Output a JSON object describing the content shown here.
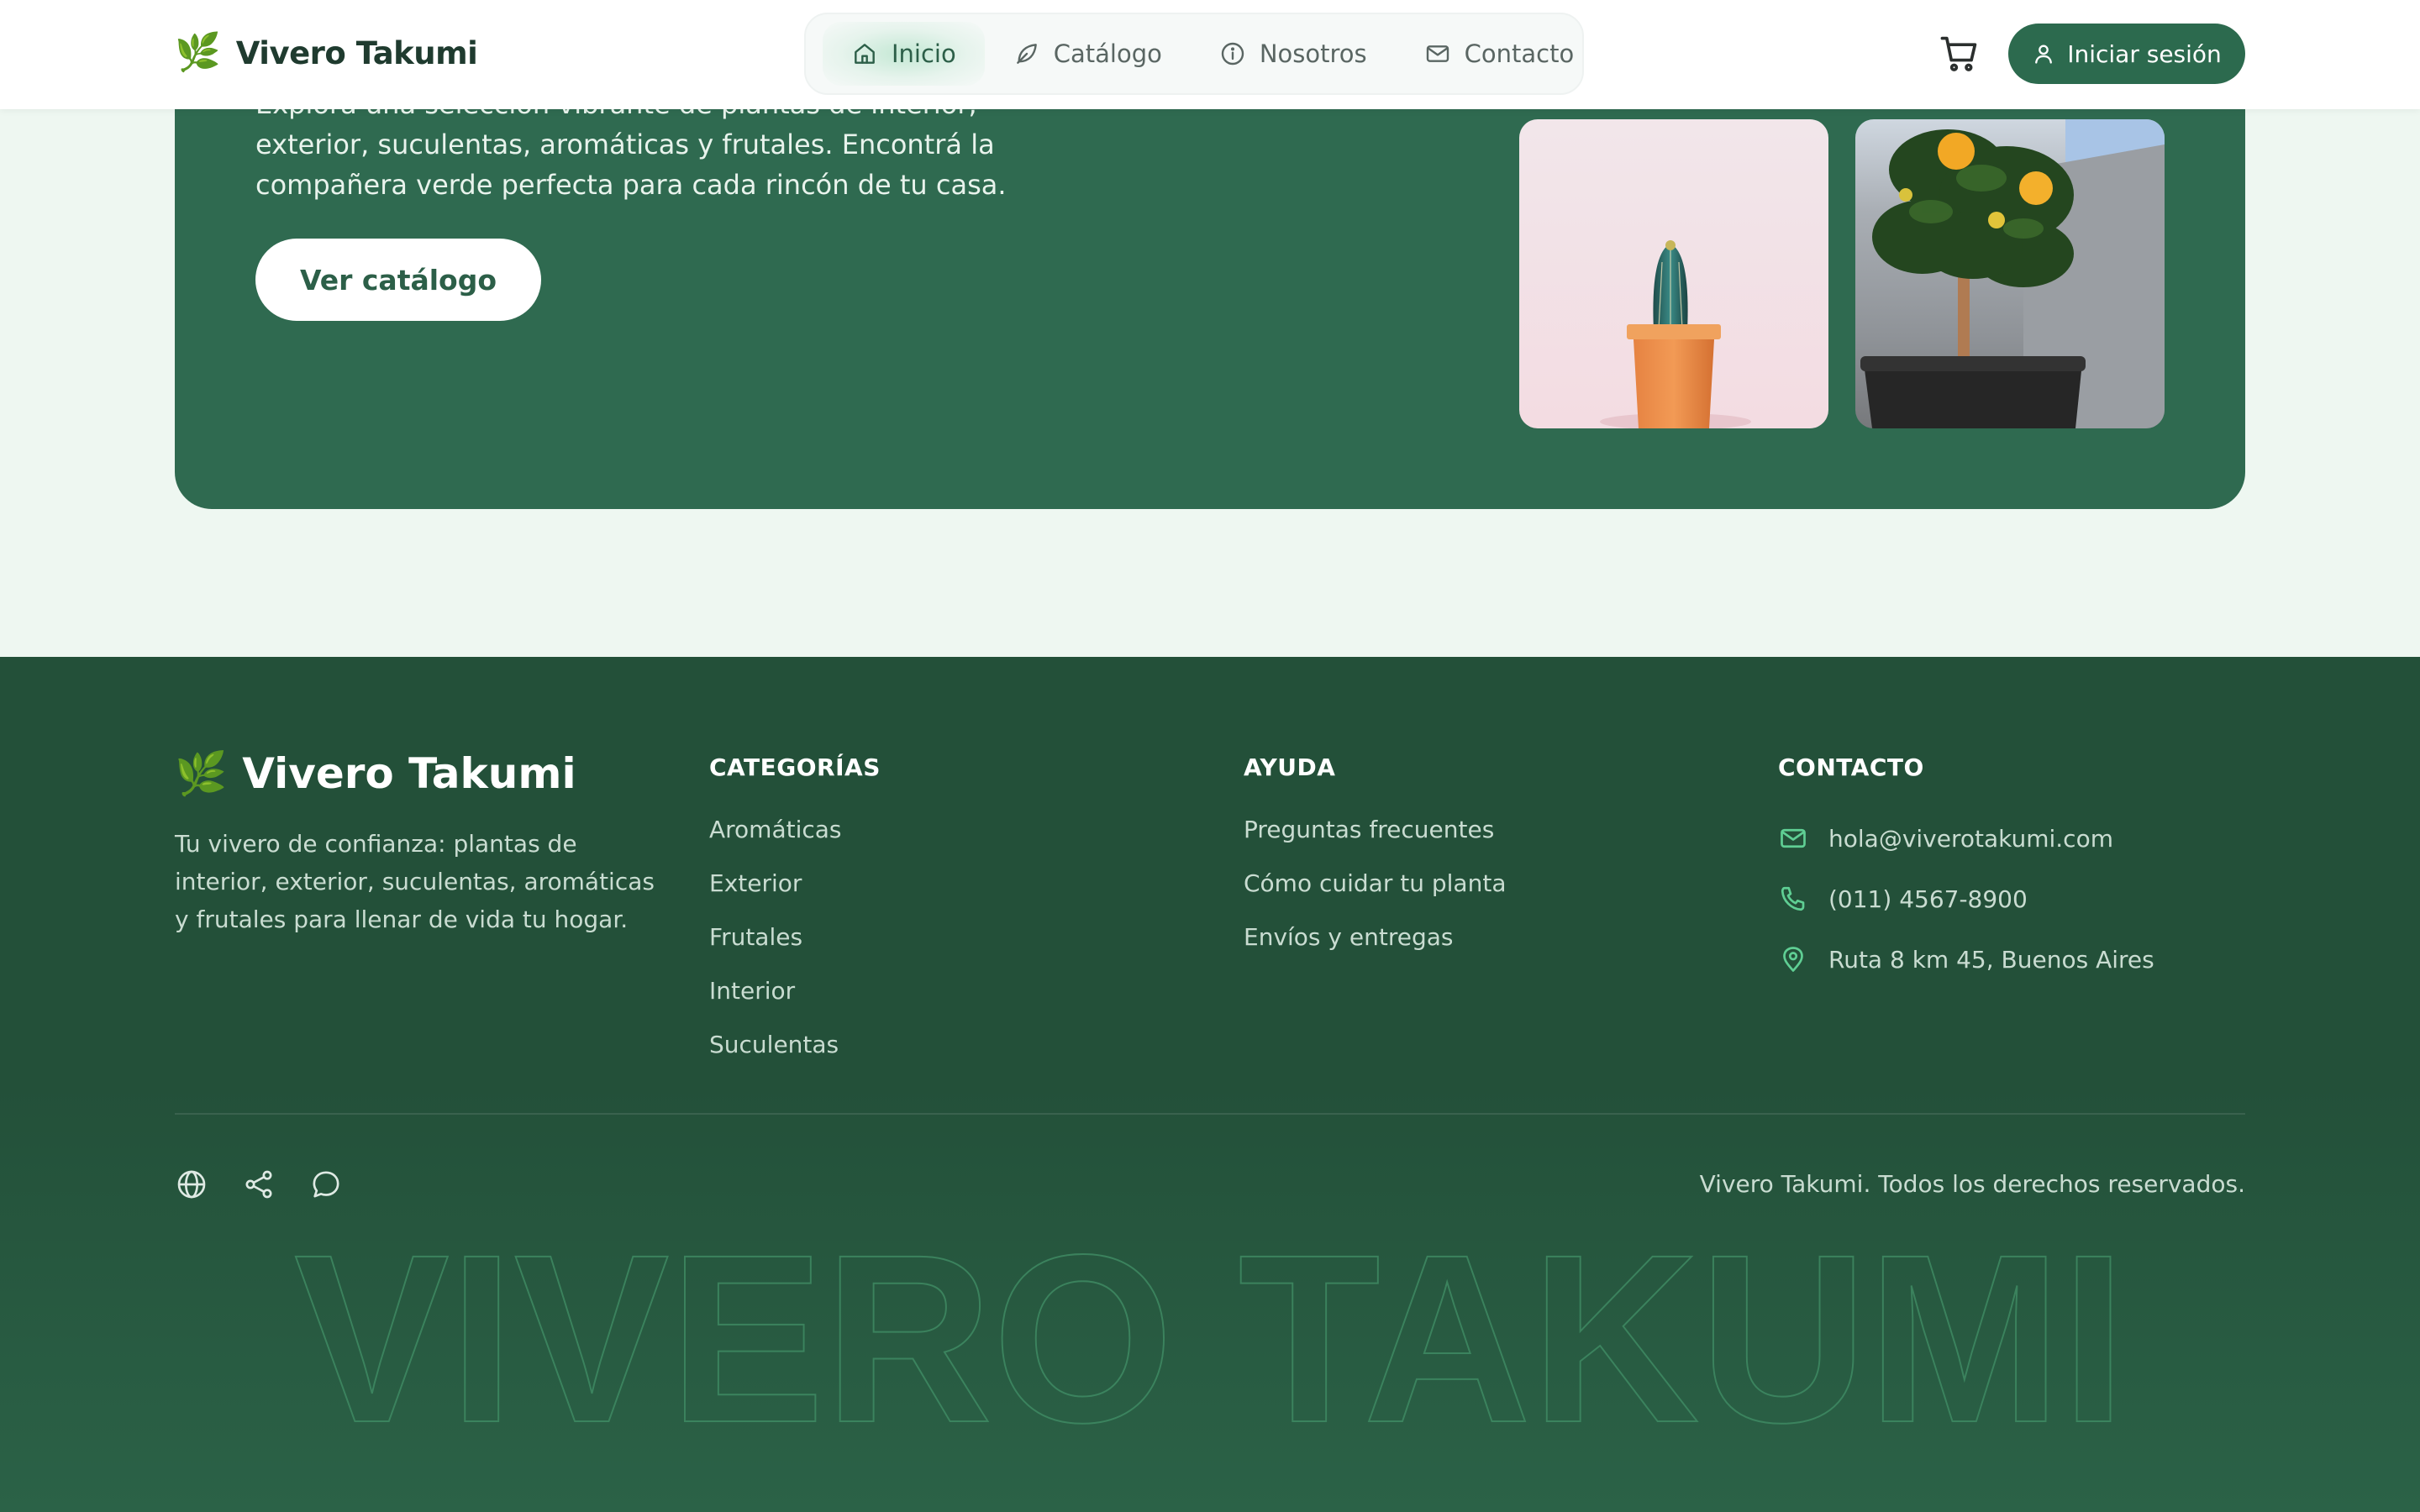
{
  "header": {
    "brand_leaf": "🌿",
    "brand_name": "Vivero Takumi",
    "nav": [
      {
        "label": "Inicio",
        "icon": "home-icon",
        "active": true
      },
      {
        "label": "Catálogo",
        "icon": "leaf-icon",
        "active": false
      },
      {
        "label": "Nosotros",
        "icon": "info-icon",
        "active": false
      },
      {
        "label": "Contacto",
        "icon": "mail-icon",
        "active": false
      }
    ],
    "cart_icon": "cart-icon",
    "login_label": "Iniciar sesión",
    "login_icon": "user-icon"
  },
  "hero": {
    "text": "Explora una selección vibrante de plantas de interior, exterior, suculentas, aromáticas y frutales. Encontrá la compañera verde perfecta para cada rincón de tu casa.",
    "cta_label": "Ver catálogo",
    "images": [
      "cactus-image",
      "lemon-tree-image"
    ]
  },
  "footer": {
    "brand_leaf": "🌿",
    "brand_name": "Vivero Takumi",
    "description": "Tu vivero de confianza: plantas de interior, exterior, suculentas, aromáticas y frutales para llenar de vida tu hogar.",
    "categories": {
      "title": "CATEGORÍAS",
      "items": [
        "Aromáticas",
        "Exterior",
        "Frutales",
        "Interior",
        "Suculentas"
      ]
    },
    "help": {
      "title": "AYUDA",
      "items": [
        "Preguntas frecuentes",
        "Cómo cuidar tu planta",
        "Envíos y entregas"
      ]
    },
    "contact": {
      "title": "CONTACTO",
      "email": "hola@viverotakumi.com",
      "phone": "(011) 4567-8900",
      "address": "Ruta 8 km 45, Buenos Aires"
    },
    "social_icons": [
      "globe-icon",
      "share-icon",
      "chat-icon"
    ],
    "copyright": "Vivero Takumi. Todos los derechos reservados.",
    "watermark": "VIVERO TAKUMI"
  },
  "colors": {
    "primary": "#2c6a4e",
    "hero_bg": "#2f6a50",
    "footer_bg": "#235039",
    "page_bg": "#eef7f1",
    "contact_icon": "#5fcf94"
  }
}
